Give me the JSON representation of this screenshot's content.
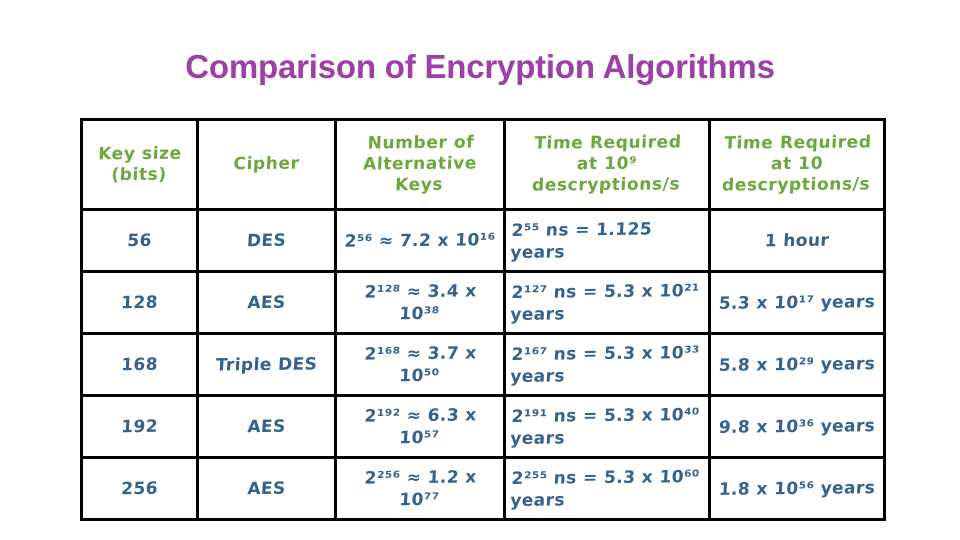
{
  "slide": {
    "title": "Comparison of Encryption Algorithms",
    "title_color": "#9c3fa6",
    "header_ink_color": "#6aa83c",
    "body_ink_color": "#34628c",
    "border_color": "#000000",
    "background_color": "#ffffff"
  },
  "table": {
    "headers": [
      {
        "lines": [
          "Key size",
          "(bits)"
        ]
      },
      {
        "lines": [
          "Cipher"
        ]
      },
      {
        "lines": [
          "Number of",
          "Alternative",
          "Keys"
        ]
      },
      {
        "lines": [
          "Time Required",
          "at 10⁹",
          "descryptions/s"
        ]
      },
      {
        "lines": [
          "Time Required",
          "at 10",
          "descryptions/s"
        ]
      }
    ],
    "headers_plain": [
      "Key size (bits)",
      "Cipher",
      "Number of Alternative Keys",
      "Time Required at 10^9 descryptions/s",
      "Time Required at 10 descryptions/s"
    ],
    "rows": [
      {
        "key_size": "56",
        "cipher": "DES",
        "alt_keys": "2⁵⁶ ≈ 7.2 x 10¹⁶",
        "time_1e9": "2⁵⁵ ns = 1.125 years",
        "time_10": "1 hour"
      },
      {
        "key_size": "128",
        "cipher": "AES",
        "alt_keys": "2¹²⁸ ≈ 3.4 x 10³⁸",
        "time_1e9": "2¹²⁷ ns = 5.3 x 10²¹ years",
        "time_10": "5.3 x 10¹⁷ years"
      },
      {
        "key_size": "168",
        "cipher": "Triple DES",
        "alt_keys": "2¹⁶⁸ ≈ 3.7 x 10⁵⁰",
        "time_1e9": "2¹⁶⁷ ns = 5.3 x 10³³ years",
        "time_10": "5.8 x 10²⁹ years"
      },
      {
        "key_size": "192",
        "cipher": "AES",
        "alt_keys": "2¹⁹² ≈ 6.3 x 10⁵⁷",
        "time_1e9": "2¹⁹¹ ns = 5.3 x 10⁴⁰ years",
        "time_10": "9.8 x 10³⁶ years"
      },
      {
        "key_size": "256",
        "cipher": "AES",
        "alt_keys": "2²⁵⁶ ≈ 1.2 x 10⁷⁷",
        "time_1e9": "2²⁵⁵ ns = 5.3 x 10⁶⁰ years",
        "time_10": "1.8 x 10⁵⁶ years"
      }
    ]
  }
}
